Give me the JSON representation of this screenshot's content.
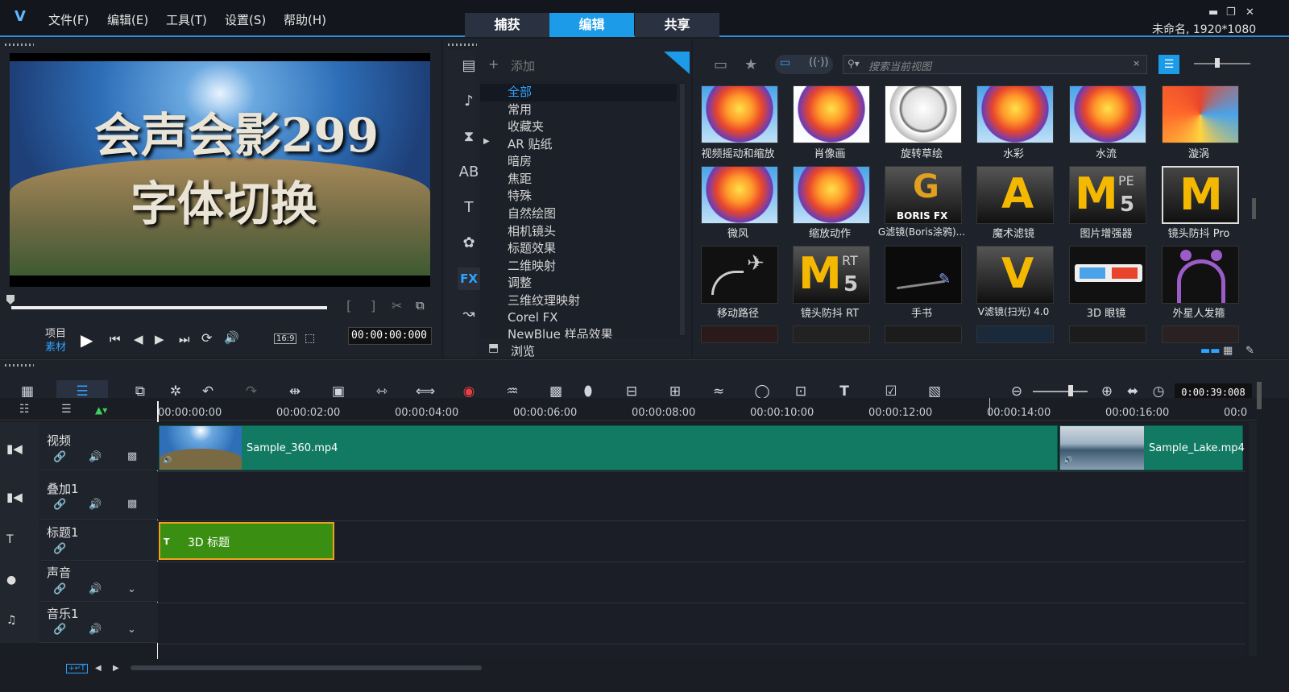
{
  "app": {
    "menu": [
      "文件(F)",
      "编辑(E)",
      "工具(T)",
      "设置(S)",
      "帮助(H)"
    ],
    "tabs": [
      "捕获",
      "编辑",
      "共享"
    ],
    "project_info": "未命名, 1920*1080"
  },
  "preview": {
    "title_line1": "会声会影299",
    "title_line2": "字体切换",
    "mode_project": "项目",
    "mode_clip": "素材",
    "aspect": "16:9",
    "timecode": "00:00:00:000",
    "progress": 0
  },
  "library": {
    "add_label": "添加",
    "search_placeholder": "搜索当前视图",
    "browse_label": "浏览",
    "categories": [
      "全部",
      "常用",
      "收藏夹",
      "AR 贴纸",
      "暗房",
      "焦距",
      "特殊",
      "自然绘图",
      "相机镜头",
      "标题效果",
      "二维映射",
      "调整",
      "三维纹理映射",
      "Corel FX",
      "NewBlue 样品效果"
    ],
    "selected_category": "全部",
    "effects": [
      [
        "视频摇动和缩放",
        "肖像画",
        "旋转草绘",
        "水彩",
        "水流",
        "漩涡"
      ],
      [
        "微风",
        "缩放动作",
        "G滤镜(Boris涂鸦)...",
        "魔术滤镜",
        "图片增强器",
        "镜头防抖 Pro"
      ],
      [
        "移动路径",
        "镜头防抖 RT",
        "手书",
        "V滤镜(扫光) 4.0",
        "3D 眼镜",
        "外星人发箍"
      ]
    ],
    "thumb_text": {
      "boris": "BORIS FX",
      "pe": "PE",
      "rt": "RT",
      "five": "5",
      "m": "M",
      "g": "G",
      "a": "A",
      "v": "V"
    }
  },
  "timeline": {
    "duration": "0:00:39:008",
    "ruler": [
      "00:00:00:00",
      "00:00:02:00",
      "00:00:04:00",
      "00:00:06:00",
      "00:00:08:00",
      "00:00:10:00",
      "00:00:12:00",
      "00:00:14:00",
      "00:00:16:00",
      "00:0"
    ],
    "tracks": [
      "视频",
      "叠加1",
      "标题1",
      "声音",
      "音乐1"
    ],
    "clips": {
      "video1": "Sample_360.mp4",
      "video2": "Sample_Lake.mp4",
      "title": "3D 标题"
    }
  },
  "colors": {
    "accent": "#1b9be8",
    "video_clip": "#127a63",
    "title_clip": "#3a8f12"
  }
}
